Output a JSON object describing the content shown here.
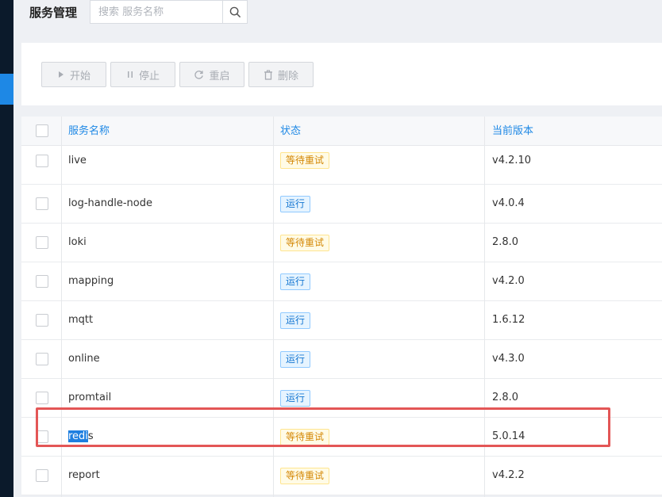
{
  "page": {
    "title": "服务管理"
  },
  "search": {
    "placeholder": "搜索 服务名称"
  },
  "toolbar": {
    "start_label": "开始",
    "stop_label": "停止",
    "restart_label": "重启",
    "delete_label": "删除"
  },
  "table": {
    "headers": {
      "name": "服务名称",
      "status": "状态",
      "version": "当前版本"
    },
    "rows": [
      {
        "name": "live",
        "status": "等待重试",
        "status_type": "wait",
        "version": "v4.2.10"
      },
      {
        "name": "log-handle-node",
        "status": "运行",
        "status_type": "run",
        "version": "v4.0.4"
      },
      {
        "name": "loki",
        "status": "等待重试",
        "status_type": "wait",
        "version": "2.8.0"
      },
      {
        "name": "mapping",
        "status": "运行",
        "status_type": "run",
        "version": "v4.2.0"
      },
      {
        "name": "mqtt",
        "status": "运行",
        "status_type": "run",
        "version": "1.6.12"
      },
      {
        "name": "online",
        "status": "运行",
        "status_type": "run",
        "version": "v4.3.0"
      },
      {
        "name": "promtail",
        "status": "运行",
        "status_type": "run",
        "version": "2.8.0"
      },
      {
        "name_selected": "redi",
        "name_rest": "s",
        "status": "等待重试",
        "status_type": "wait",
        "version": "5.0.14"
      },
      {
        "name": "report",
        "status": "等待重试",
        "status_type": "wait",
        "version": "v4.2.2"
      }
    ]
  },
  "colors": {
    "accent": "#1e88e5",
    "highlight": "#e35656",
    "sidebar": "#0b1a2b"
  }
}
